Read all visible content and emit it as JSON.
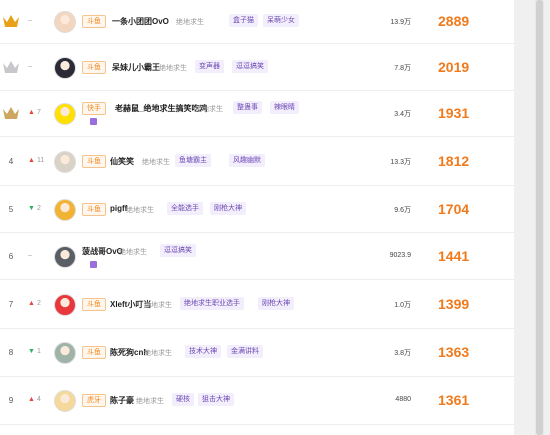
{
  "rows": [
    {
      "rank": "",
      "crown": "gold",
      "trend": "–",
      "dir": "none",
      "platform": "斗鱼",
      "name": "一条小团团OvO",
      "game": "绝地求生",
      "tags": [
        "盒子猫",
        "呆萌少女"
      ],
      "fans": "13.9万",
      "score": "2889",
      "badge": false,
      "avatar_color": "#f3d6bf",
      "avatar_icon": "cat-girl-avatar"
    },
    {
      "rank": "",
      "crown": "silver",
      "trend": "–",
      "dir": "none",
      "platform": "斗鱼",
      "name": "呆妹儿小霸王",
      "game": "绝地求生",
      "tags": [
        "变声器",
        "逗逗搞笑"
      ],
      "fans": "7.8万",
      "score": "2019",
      "badge": false,
      "avatar_color": "#2b2b38",
      "avatar_icon": "anime-girl-avatar"
    },
    {
      "rank": "",
      "crown": "bronze",
      "trend": "7",
      "dir": "up",
      "platform": "快手",
      "name": "老赫鼠_绝地求生搞笑吃鸡",
      "game": "绝地求生",
      "tags": [
        "整蛊事",
        "辣眼睛"
      ],
      "fans": "3.4万",
      "score": "1931",
      "badge": true,
      "avatar_color": "#ffe000",
      "avatar_icon": "yellow-face-avatar"
    },
    {
      "rank": "4",
      "crown": "",
      "trend": "11",
      "dir": "up",
      "platform": "斗鱼",
      "name": "仙笑笑",
      "game": "绝地求生",
      "tags": [
        "鱼塘霸主",
        "风趣幽默"
      ],
      "fans": "13.3万",
      "score": "1812",
      "badge": false,
      "avatar_color": "#d9d2c7",
      "avatar_icon": "girl-avatar"
    },
    {
      "rank": "5",
      "crown": "",
      "trend": "2",
      "dir": "down",
      "platform": "斗鱼",
      "name": "pigff",
      "game": "绝地求生",
      "tags": [
        "全能选手",
        "刚枪大神"
      ],
      "fans": "9.6万",
      "score": "1704",
      "badge": false,
      "avatar_color": "#f2b233",
      "avatar_icon": "cartoon-avatar"
    },
    {
      "rank": "6",
      "crown": "",
      "trend": "–",
      "dir": "none",
      "platform": "",
      "name": "菠战哥OvO",
      "game": "绝地求生",
      "tags": [
        "逗逗搞笑"
      ],
      "fans": "9023.9",
      "score": "1441",
      "badge": true,
      "avatar_color": "#5a5f66",
      "avatar_icon": "dark-avatar"
    },
    {
      "rank": "7",
      "crown": "",
      "trend": "2",
      "dir": "up",
      "platform": "斗鱼",
      "name": "Xleft小叮当",
      "game": "绝地求生",
      "tags": [
        "绝地求生职业选手",
        "刚枪大神"
      ],
      "fans": "1.0万",
      "score": "1399",
      "badge": false,
      "avatar_color": "#e8383d",
      "avatar_icon": "red-mascot-avatar"
    },
    {
      "rank": "8",
      "crown": "",
      "trend": "1",
      "dir": "down",
      "platform": "斗鱼",
      "name": "陈死狗cnh",
      "game": "绝地求生",
      "tags": [
        "技术大神",
        "金满讲料"
      ],
      "fans": "3.8万",
      "score": "1363",
      "badge": false,
      "avatar_color": "#9fb3a8",
      "avatar_icon": "landscape-avatar"
    },
    {
      "rank": "9",
      "crown": "",
      "trend": "4",
      "dir": "up",
      "platform": "虎牙",
      "name": "陈子豪",
      "game": "绝地求生",
      "tags": [
        "硬核",
        "狙击大神"
      ],
      "fans": "4880",
      "score": "1361",
      "badge": false,
      "avatar_color": "#f5d99a",
      "avatar_icon": "blonde-anime-avatar"
    }
  ],
  "colors": {
    "score": "#f07a1c",
    "up": "#e8453c",
    "down": "#2db35d",
    "gold": "#e8a21a",
    "silver": "#c8c8cc",
    "bronze": "#cda660",
    "tag_bg": "#f3eefc",
    "tag_text": "#6e4ab5"
  }
}
